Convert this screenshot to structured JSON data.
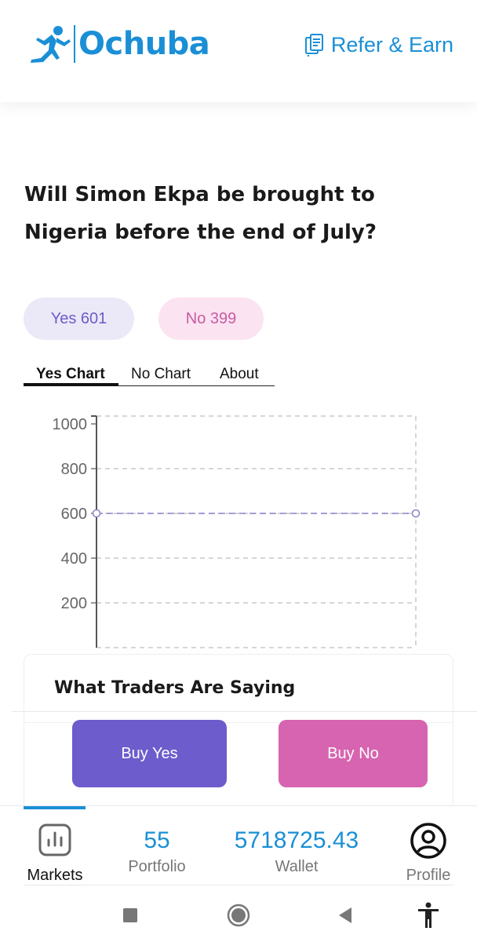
{
  "header": {
    "brand": "Ochuba",
    "refer_label": "Refer & Earn",
    "accent_color": "#1a8fd6",
    "icons": {
      "logo": "runner-logo-icon",
      "refer": "document-icon"
    }
  },
  "market": {
    "question": "Will Simon Ekpa be brought to Nigeria before the end of July?",
    "yes_label": "Yes 601",
    "no_label": "No 399"
  },
  "tabs": [
    {
      "label": "Yes Chart",
      "active": true
    },
    {
      "label": "No Chart",
      "active": false
    },
    {
      "label": "About",
      "active": false
    }
  ],
  "chart_data": {
    "type": "line",
    "x": [
      0,
      1
    ],
    "series": [
      {
        "values": [
          600,
          600
        ],
        "color": "#8a85c9"
      }
    ],
    "y_ticks": [
      1000,
      800,
      600,
      400,
      200
    ],
    "ylim": [
      0,
      1000
    ],
    "grid": true
  },
  "traders": {
    "title": "What Traders Are Saying",
    "buy_yes_label": "Buy Yes",
    "buy_no_label": "Buy No",
    "buy_yes_color": "#6c5ccc",
    "buy_no_color": "#d764b0"
  },
  "bottom_nav": {
    "markets_label": "Markets",
    "portfolio_value": "55",
    "portfolio_label": "Portfolio",
    "wallet_value": "5718725.43",
    "wallet_label": "Wallet",
    "profile_label": "Profile",
    "icons": {
      "markets": "bar-chart-icon",
      "profile": "user-circle-icon"
    }
  },
  "system_nav": {
    "icons": [
      "recents-square-icon",
      "home-circle-icon",
      "back-triangle-icon",
      "accessibility-icon"
    ]
  }
}
